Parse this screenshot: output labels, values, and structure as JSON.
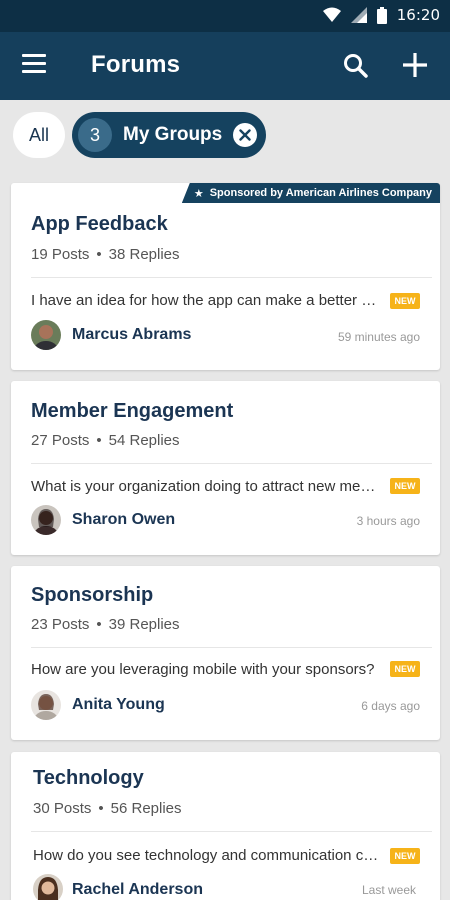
{
  "status_bar": {
    "time": "16:20",
    "icons": [
      "wifi-icon",
      "signal-icon",
      "battery-icon"
    ]
  },
  "app_bar": {
    "title": "Forums",
    "icons": [
      "menu-icon",
      "search-icon",
      "add-icon"
    ]
  },
  "filters": {
    "all_label": "All",
    "groups_count": "3",
    "groups_label": "My Groups"
  },
  "forums": [
    {
      "title": "App Feedback",
      "posts": "19 Posts",
      "replies": "38 Replies",
      "sponsor": "Sponsored by American Airlines Company",
      "preview": "I have an idea for how the app can make a better experience",
      "badge": "NEW",
      "author": "Marcus Abrams",
      "time": "59 minutes ago"
    },
    {
      "title": "Member Engagement",
      "posts": "27 Posts",
      "replies": "54 Replies",
      "preview": "What is your organization doing to attract new members?",
      "badge": "NEW",
      "author": "Sharon Owen",
      "time": "3 hours ago"
    },
    {
      "title": "Sponsorship",
      "posts": "23 Posts",
      "replies": "39 Replies",
      "preview": "How are you leveraging mobile with your sponsors?",
      "badge": "NEW",
      "author": "Anita Young",
      "time": "6 days ago"
    },
    {
      "title": "Technology",
      "posts": "30 Posts",
      "replies": "56 Replies",
      "preview": "How do you see technology and communication changing?",
      "badge": "NEW",
      "author": "Rachel Anderson",
      "time": "Last week"
    }
  ],
  "colors": {
    "primary": "#153f5c",
    "status_bar": "#0d2f45",
    "badge": "#f6b319",
    "title_text": "#1b3553",
    "background": "#e7e7e7"
  }
}
